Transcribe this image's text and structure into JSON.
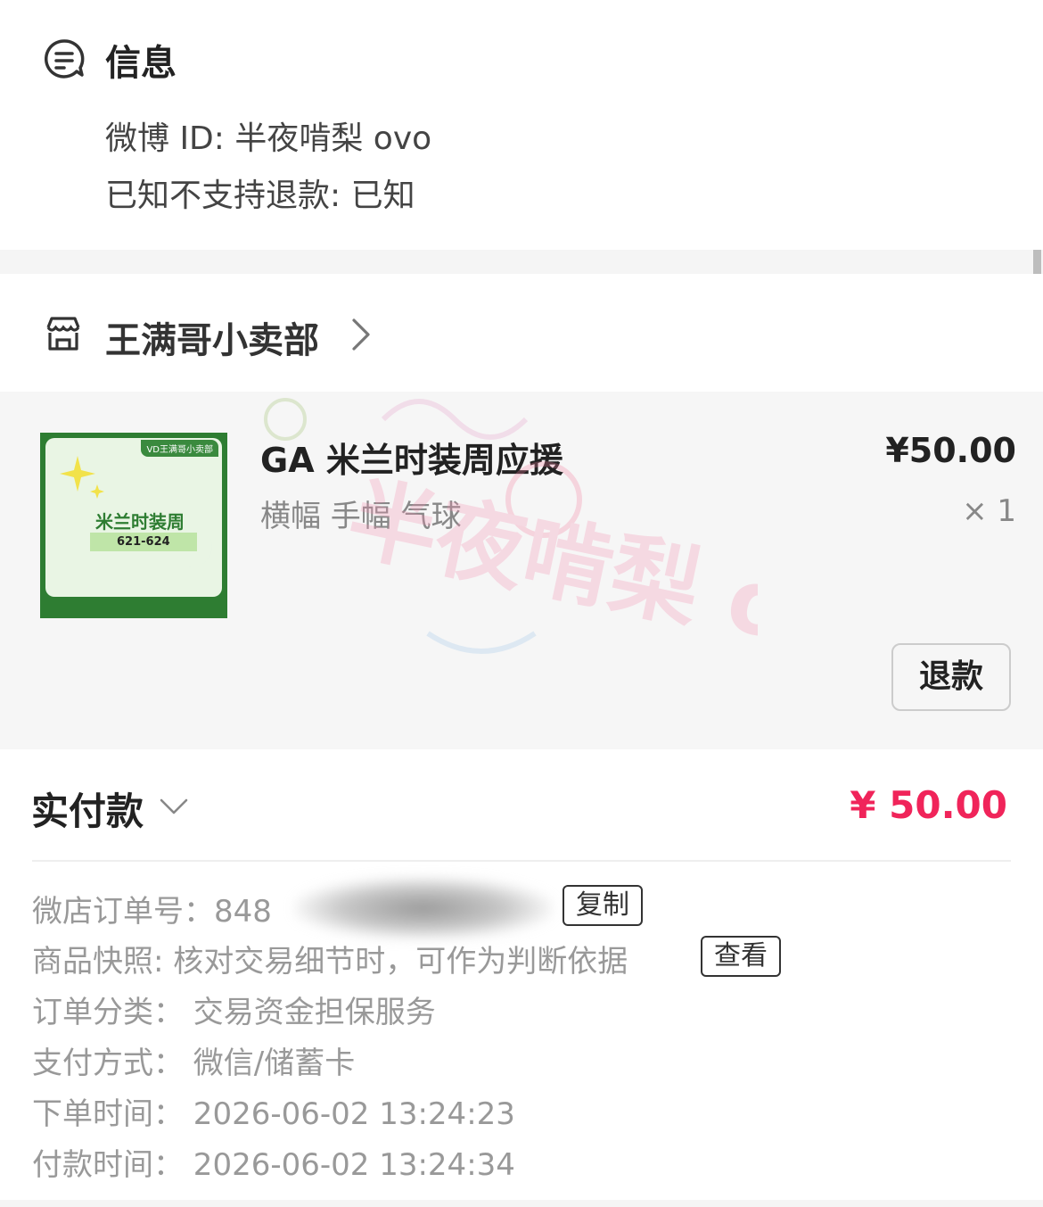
{
  "info": {
    "title": "信息",
    "weibo_id": "微博 ID: 半夜啃梨 ovo",
    "refund_notice": "已知不支持退款: 已知"
  },
  "shop": {
    "name": "王满哥小卖部"
  },
  "item": {
    "thumb_tag": "VD王满哥小卖部",
    "thumb_title": "米兰时装周",
    "thumb_date": "621-624",
    "title": "GA 米兰时装周应援",
    "spec": "横幅 手幅 气球",
    "price": "¥50.00",
    "qty": "× 1",
    "refund_button": "退款"
  },
  "payment": {
    "label": "实付款",
    "amount": "¥ 50.00",
    "order_no_label": "微店订单号：",
    "order_no_value": "848",
    "copy_button": "复制",
    "snapshot_label": "商品快照: 核对交易细节时，可作为判断依据",
    "view_button": "查看",
    "category": "订单分类：  交易资金担保服务",
    "method": "支付方式：  微信/储蓄卡",
    "order_time": "下单时间：  2026-06-02 13:24:23",
    "pay_time": "付款时间：  2026-06-02 13:24:34"
  },
  "watermark": {
    "text": "半夜啃梨 ovo"
  },
  "icons": {
    "info": "message-lines-icon",
    "shop": "store-icon",
    "chevron_right": "chevron-right-icon",
    "chevron_down": "chevron-down-icon"
  },
  "colors": {
    "accent_price": "#f0245a",
    "thumb_green": "#2e7d32"
  }
}
